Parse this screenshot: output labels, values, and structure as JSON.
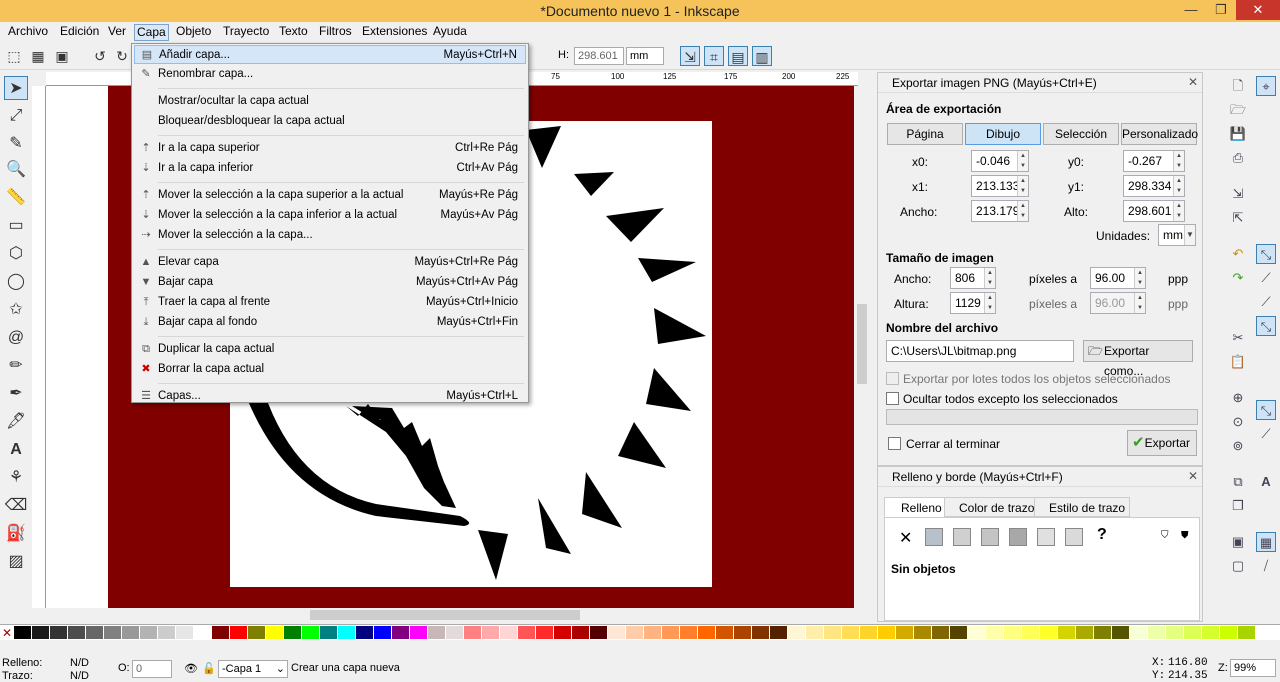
{
  "window": {
    "title": "*Documento nuevo 1 - Inkscape",
    "min": "—",
    "max": "❐",
    "close": "✕"
  },
  "menubar": [
    "Archivo",
    "Edición",
    "Ver",
    "Capa",
    "Objeto",
    "Trayecto",
    "Texto",
    "Filtros",
    "Extensiones",
    "Ayuda"
  ],
  "toolbar": {
    "h_label": "H:",
    "h_value": "298.601",
    "unit": "mm"
  },
  "ruler_ticks": [
    "75",
    "100",
    "125",
    "150",
    "175",
    "200",
    "225"
  ],
  "capa_menu": [
    {
      "label": "Añadir capa...",
      "shortcut": "Mayús+Ctrl+N",
      "icon": "add-layer-icon",
      "hl": true
    },
    {
      "label": "Renombrar capa...",
      "shortcut": "",
      "icon": "rename-layer-icon"
    },
    {
      "sep": true
    },
    {
      "label": "Mostrar/ocultar la capa actual",
      "shortcut": ""
    },
    {
      "label": "Bloquear/desbloquear la capa actual",
      "shortcut": ""
    },
    {
      "sep": true
    },
    {
      "label": "Ir a la capa superior",
      "shortcut": "Ctrl+Re Pág",
      "icon": "layer-up-icon"
    },
    {
      "label": "Ir a la capa inferior",
      "shortcut": "Ctrl+Av Pág",
      "icon": "layer-down-icon"
    },
    {
      "sep": true
    },
    {
      "label": "Mover la selección a la capa superior a la actual",
      "shortcut": "Mayús+Re Pág",
      "icon": "move-up-icon"
    },
    {
      "label": "Mover la selección a la capa inferior a la actual",
      "shortcut": "Mayús+Av Pág",
      "icon": "move-down-icon"
    },
    {
      "label": "Mover la selección a la capa...",
      "shortcut": "",
      "icon": "move-to-icon"
    },
    {
      "sep": true
    },
    {
      "label": "Elevar capa",
      "shortcut": "Mayús+Ctrl+Re Pág",
      "icon": "raise-layer-icon"
    },
    {
      "label": "Bajar capa",
      "shortcut": "Mayús+Ctrl+Av Pág",
      "icon": "lower-layer-icon"
    },
    {
      "label": "Traer la capa al frente",
      "shortcut": "Mayús+Ctrl+Inicio",
      "icon": "layer-top-icon"
    },
    {
      "label": "Bajar capa al fondo",
      "shortcut": "Mayús+Ctrl+Fin",
      "icon": "layer-bottom-icon"
    },
    {
      "sep": true
    },
    {
      "label": "Duplicar la capa actual",
      "shortcut": "",
      "icon": "duplicate-layer-icon"
    },
    {
      "label": "Borrar la capa actual",
      "shortcut": "",
      "icon": "delete-layer-icon"
    },
    {
      "sep": true
    },
    {
      "label": "Capas...",
      "shortcut": "Mayús+Ctrl+L",
      "icon": "layers-dialog-icon"
    }
  ],
  "export": {
    "header": "Exportar imagen PNG (Mayús+Ctrl+E)",
    "area_title": "Área de exportación",
    "tabs": [
      "Página",
      "Dibujo",
      "Selección",
      "Personalizado"
    ],
    "x0_label": "x0:",
    "x0": "-0.046",
    "y0_label": "y0:",
    "y0": "-0.267",
    "x1_label": "x1:",
    "x1": "213.133",
    "y1_label": "y1:",
    "y1": "298.334",
    "ancho_label": "Ancho:",
    "ancho": "213.179",
    "alto_label": "Alto:",
    "alto": "298.601",
    "units_label": "Unidades:",
    "units": "mm",
    "size_title": "Tamaño de imagen",
    "img_ancho_label": "Ancho:",
    "img_ancho": "806",
    "img_alto_label": "Altura:",
    "img_alto": "1129",
    "px_a": "píxeles a",
    "dpi1": "96.00",
    "dpi2": "96.00",
    "ppp": "ppp",
    "file_title": "Nombre del archivo",
    "file": "C:\\Users\\JL\\bitmap.png",
    "export_as": "Exportar como...",
    "batch": "Exportar por lotes todos los objetos seleccionados",
    "hide": "Ocultar todos excepto los seleccionados",
    "close_when": "Cerrar al terminar",
    "export_btn": "Exportar"
  },
  "fill": {
    "header": "Relleno y borde (Mayús+Ctrl+F)",
    "tabs": [
      "Relleno",
      "Color de trazo",
      "Estilo de trazo"
    ],
    "none": "✕",
    "unknown": "?",
    "status": "Sin objetos"
  },
  "status": {
    "fill_label": "Relleno:",
    "fill": "N/D",
    "stroke_label": "Trazo:",
    "stroke": "N/D",
    "o_label": "O:",
    "o_value": "0",
    "layer": "-Capa 1",
    "message": "Crear una capa nueva",
    "x_label": "X:",
    "x": "116.80",
    "y_label": "Y:",
    "y": "214.35",
    "z_label": "Z:",
    "zoom": "99%"
  },
  "colors": {
    "accent": "#f6c35b",
    "page_bg": "#800000"
  }
}
